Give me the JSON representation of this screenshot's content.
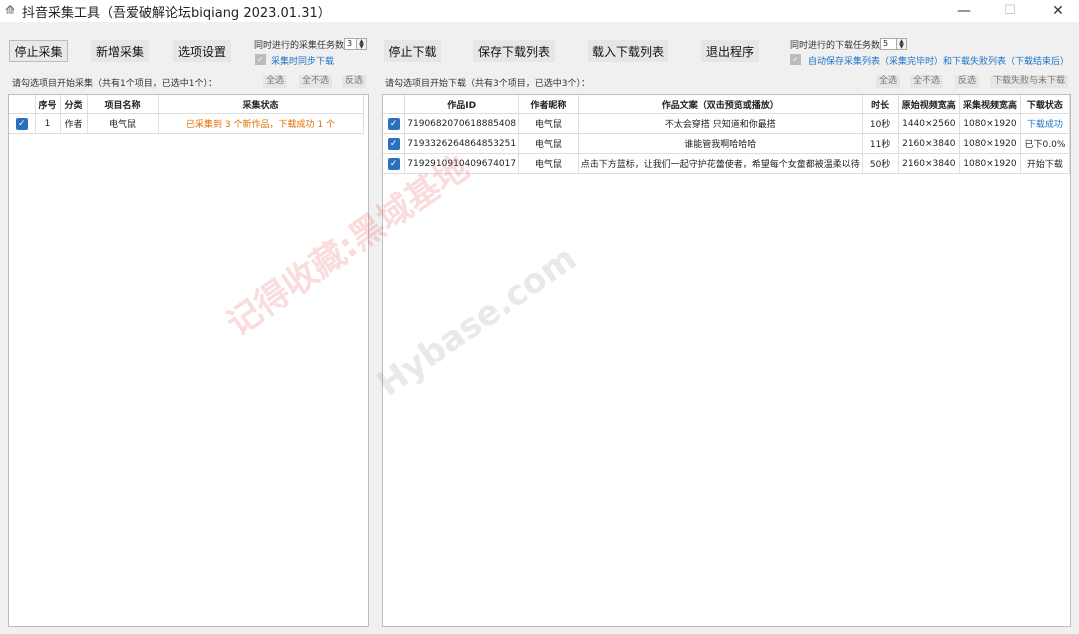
{
  "window": {
    "title": "抖音采集工具（吾爱破解论坛biqiang 2023.01.31）",
    "minimize": "—",
    "maximize": "☐",
    "close": "✕"
  },
  "left_toolbar": {
    "stop_collect": "停止采集",
    "add_collect": "新增采集",
    "options": "选项设置",
    "concurrent_label": "同时进行的采集任务数",
    "concurrent_value": "3",
    "sync_download_label": "采集时同步下载"
  },
  "right_toolbar": {
    "stop_download": "停止下载",
    "save_list": "保存下载列表",
    "load_list": "载入下载列表",
    "exit": "退出程序",
    "concurrent_label": "同时进行的下载任务数",
    "concurrent_value": "5",
    "autosave_label": "自动保存采集列表（采集完毕时）和下载失败列表（下载结束后）"
  },
  "left_panel": {
    "hint": "请勾选项目开始采集（共有1个项目，已选中1个）：",
    "select_all": "全选",
    "select_none": "全不选",
    "invert": "反选",
    "columns": [
      "序号",
      "分类",
      "项目名称",
      "采集状态"
    ],
    "rows": [
      {
        "index": "1",
        "category": "作者",
        "name": "电气鼠",
        "status": "已采集到 3 个新作品，下载成功 1 个"
      }
    ]
  },
  "right_panel": {
    "hint": "请勾选项目开始下载（共有3个项目，已选中3个）：",
    "select_all": "全选",
    "select_none": "全不选",
    "invert": "反选",
    "fail_unfinished": "下载失败与未下载",
    "columns": [
      "作品ID",
      "作者昵称",
      "作品文案（双击预览或播放）",
      "时长",
      "原始视频宽高",
      "采集视频宽高",
      "下载状态"
    ],
    "rows": [
      {
        "id": "7190682070618885408",
        "author": "电气鼠",
        "caption": "不太会穿搭 只知道和你最搭",
        "duration": "10秒",
        "orig_size": "1440×2560",
        "coll_size": "1080×1920",
        "status": "下载成功"
      },
      {
        "id": "7193326264864853251",
        "author": "电气鼠",
        "caption": "谁能管我啊哈哈哈",
        "duration": "11秒",
        "orig_size": "2160×3840",
        "coll_size": "1080×1920",
        "status": "已下0.0%"
      },
      {
        "id": "7192910910409674017",
        "author": "电气鼠",
        "caption": "点击下方蓝标，让我们一起守护花蕾使者，希望每个女童都被温柔以待",
        "duration": "50秒",
        "orig_size": "2160×3840",
        "coll_size": "1080×1920",
        "status": "开始下载"
      }
    ]
  },
  "watermark": {
    "line1": "记得收藏:黑域基地",
    "line2": "Hybase.com"
  },
  "colors": {
    "accent": "#2b6fbf",
    "status_orange": "#e06c00",
    "status_blue": "#1a73c8"
  }
}
